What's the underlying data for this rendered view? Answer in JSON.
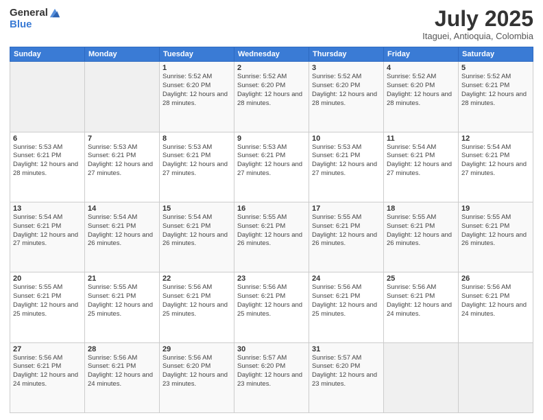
{
  "header": {
    "logo_line1": "General",
    "logo_line2": "Blue",
    "month_year": "July 2025",
    "location": "Itaguei, Antioquia, Colombia"
  },
  "weekdays": [
    "Sunday",
    "Monday",
    "Tuesday",
    "Wednesday",
    "Thursday",
    "Friday",
    "Saturday"
  ],
  "weeks": [
    [
      {
        "day": "",
        "sunrise": "",
        "sunset": "",
        "daylight": ""
      },
      {
        "day": "",
        "sunrise": "",
        "sunset": "",
        "daylight": ""
      },
      {
        "day": "1",
        "sunrise": "Sunrise: 5:52 AM",
        "sunset": "Sunset: 6:20 PM",
        "daylight": "Daylight: 12 hours and 28 minutes."
      },
      {
        "day": "2",
        "sunrise": "Sunrise: 5:52 AM",
        "sunset": "Sunset: 6:20 PM",
        "daylight": "Daylight: 12 hours and 28 minutes."
      },
      {
        "day": "3",
        "sunrise": "Sunrise: 5:52 AM",
        "sunset": "Sunset: 6:20 PM",
        "daylight": "Daylight: 12 hours and 28 minutes."
      },
      {
        "day": "4",
        "sunrise": "Sunrise: 5:52 AM",
        "sunset": "Sunset: 6:20 PM",
        "daylight": "Daylight: 12 hours and 28 minutes."
      },
      {
        "day": "5",
        "sunrise": "Sunrise: 5:52 AM",
        "sunset": "Sunset: 6:21 PM",
        "daylight": "Daylight: 12 hours and 28 minutes."
      }
    ],
    [
      {
        "day": "6",
        "sunrise": "Sunrise: 5:53 AM",
        "sunset": "Sunset: 6:21 PM",
        "daylight": "Daylight: 12 hours and 28 minutes."
      },
      {
        "day": "7",
        "sunrise": "Sunrise: 5:53 AM",
        "sunset": "Sunset: 6:21 PM",
        "daylight": "Daylight: 12 hours and 27 minutes."
      },
      {
        "day": "8",
        "sunrise": "Sunrise: 5:53 AM",
        "sunset": "Sunset: 6:21 PM",
        "daylight": "Daylight: 12 hours and 27 minutes."
      },
      {
        "day": "9",
        "sunrise": "Sunrise: 5:53 AM",
        "sunset": "Sunset: 6:21 PM",
        "daylight": "Daylight: 12 hours and 27 minutes."
      },
      {
        "day": "10",
        "sunrise": "Sunrise: 5:53 AM",
        "sunset": "Sunset: 6:21 PM",
        "daylight": "Daylight: 12 hours and 27 minutes."
      },
      {
        "day": "11",
        "sunrise": "Sunrise: 5:54 AM",
        "sunset": "Sunset: 6:21 PM",
        "daylight": "Daylight: 12 hours and 27 minutes."
      },
      {
        "day": "12",
        "sunrise": "Sunrise: 5:54 AM",
        "sunset": "Sunset: 6:21 PM",
        "daylight": "Daylight: 12 hours and 27 minutes."
      }
    ],
    [
      {
        "day": "13",
        "sunrise": "Sunrise: 5:54 AM",
        "sunset": "Sunset: 6:21 PM",
        "daylight": "Daylight: 12 hours and 27 minutes."
      },
      {
        "day": "14",
        "sunrise": "Sunrise: 5:54 AM",
        "sunset": "Sunset: 6:21 PM",
        "daylight": "Daylight: 12 hours and 26 minutes."
      },
      {
        "day": "15",
        "sunrise": "Sunrise: 5:54 AM",
        "sunset": "Sunset: 6:21 PM",
        "daylight": "Daylight: 12 hours and 26 minutes."
      },
      {
        "day": "16",
        "sunrise": "Sunrise: 5:55 AM",
        "sunset": "Sunset: 6:21 PM",
        "daylight": "Daylight: 12 hours and 26 minutes."
      },
      {
        "day": "17",
        "sunrise": "Sunrise: 5:55 AM",
        "sunset": "Sunset: 6:21 PM",
        "daylight": "Daylight: 12 hours and 26 minutes."
      },
      {
        "day": "18",
        "sunrise": "Sunrise: 5:55 AM",
        "sunset": "Sunset: 6:21 PM",
        "daylight": "Daylight: 12 hours and 26 minutes."
      },
      {
        "day": "19",
        "sunrise": "Sunrise: 5:55 AM",
        "sunset": "Sunset: 6:21 PM",
        "daylight": "Daylight: 12 hours and 26 minutes."
      }
    ],
    [
      {
        "day": "20",
        "sunrise": "Sunrise: 5:55 AM",
        "sunset": "Sunset: 6:21 PM",
        "daylight": "Daylight: 12 hours and 25 minutes."
      },
      {
        "day": "21",
        "sunrise": "Sunrise: 5:55 AM",
        "sunset": "Sunset: 6:21 PM",
        "daylight": "Daylight: 12 hours and 25 minutes."
      },
      {
        "day": "22",
        "sunrise": "Sunrise: 5:56 AM",
        "sunset": "Sunset: 6:21 PM",
        "daylight": "Daylight: 12 hours and 25 minutes."
      },
      {
        "day": "23",
        "sunrise": "Sunrise: 5:56 AM",
        "sunset": "Sunset: 6:21 PM",
        "daylight": "Daylight: 12 hours and 25 minutes."
      },
      {
        "day": "24",
        "sunrise": "Sunrise: 5:56 AM",
        "sunset": "Sunset: 6:21 PM",
        "daylight": "Daylight: 12 hours and 25 minutes."
      },
      {
        "day": "25",
        "sunrise": "Sunrise: 5:56 AM",
        "sunset": "Sunset: 6:21 PM",
        "daylight": "Daylight: 12 hours and 24 minutes."
      },
      {
        "day": "26",
        "sunrise": "Sunrise: 5:56 AM",
        "sunset": "Sunset: 6:21 PM",
        "daylight": "Daylight: 12 hours and 24 minutes."
      }
    ],
    [
      {
        "day": "27",
        "sunrise": "Sunrise: 5:56 AM",
        "sunset": "Sunset: 6:21 PM",
        "daylight": "Daylight: 12 hours and 24 minutes."
      },
      {
        "day": "28",
        "sunrise": "Sunrise: 5:56 AM",
        "sunset": "Sunset: 6:21 PM",
        "daylight": "Daylight: 12 hours and 24 minutes."
      },
      {
        "day": "29",
        "sunrise": "Sunrise: 5:56 AM",
        "sunset": "Sunset: 6:20 PM",
        "daylight": "Daylight: 12 hours and 23 minutes."
      },
      {
        "day": "30",
        "sunrise": "Sunrise: 5:57 AM",
        "sunset": "Sunset: 6:20 PM",
        "daylight": "Daylight: 12 hours and 23 minutes."
      },
      {
        "day": "31",
        "sunrise": "Sunrise: 5:57 AM",
        "sunset": "Sunset: 6:20 PM",
        "daylight": "Daylight: 12 hours and 23 minutes."
      },
      {
        "day": "",
        "sunrise": "",
        "sunset": "",
        "daylight": ""
      },
      {
        "day": "",
        "sunrise": "",
        "sunset": "",
        "daylight": ""
      }
    ]
  ]
}
